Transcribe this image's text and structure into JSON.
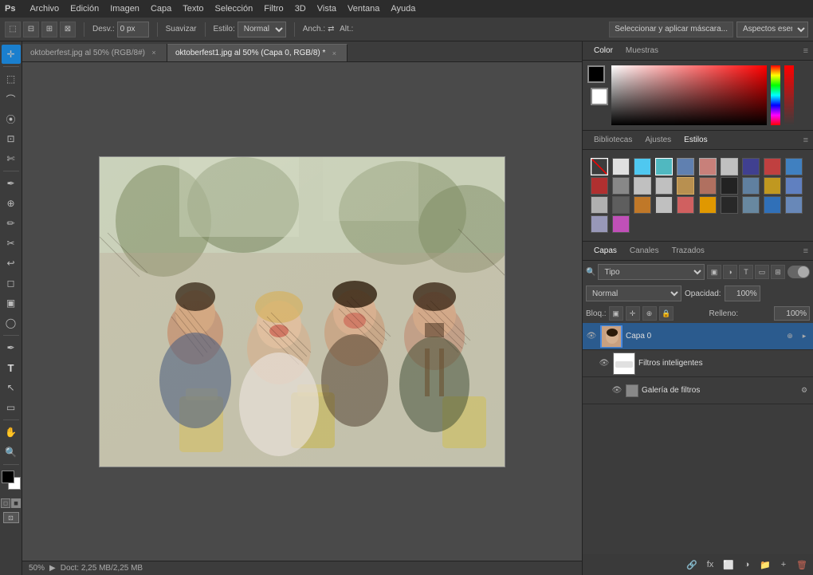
{
  "app": {
    "logo": "Ps",
    "menu_items": [
      "Archivo",
      "Edición",
      "Imagen",
      "Capa",
      "Texto",
      "Selección",
      "Filtro",
      "3D",
      "Vista",
      "Ventana",
      "Ayuda"
    ]
  },
  "toolbar": {
    "desv_label": "Desv.:",
    "desv_value": "0 px",
    "suavizar_label": "Suavizar",
    "estilo_label": "Estilo:",
    "estilo_value": "Normal",
    "anch_label": "Anch.:",
    "alt_label": "Alt.:",
    "mask_button": "Seleccionar y aplicar máscara...",
    "aspects_button": "Aspectos esen."
  },
  "tabs": [
    {
      "label": "oktoberfest.jpg al 50% (RGB/8#)",
      "active": false,
      "modified": false
    },
    {
      "label": "oktoberfest1.jpg al 50% (Capa 0, RGB/8) *",
      "active": true,
      "modified": true
    }
  ],
  "color_panel": {
    "tabs": [
      "Color",
      "Muestras"
    ],
    "active_tab": "Color"
  },
  "styles_panel": {
    "tabs": [
      "Bibliotecas",
      "Ajustes",
      "Estilos"
    ],
    "active_tab": "Estilos"
  },
  "layers_panel": {
    "tabs": [
      "Capas",
      "Canales",
      "Trazados"
    ],
    "active_tab": "Capas",
    "blend_mode": "Normal",
    "opacity_label": "Opacidad:",
    "opacity_value": "100%",
    "lock_label": "Bloq.:",
    "fill_label": "Relleno:",
    "fill_value": "100%",
    "filter_options": [
      "Tipo"
    ],
    "layers": [
      {
        "name": "Capa 0",
        "visible": true,
        "active": true,
        "type": "normal",
        "has_fx": true
      },
      {
        "name": "Filtros inteligentes",
        "visible": true,
        "active": false,
        "type": "filter-group",
        "indent": true
      },
      {
        "name": "Galería de filtros",
        "visible": true,
        "active": false,
        "type": "filter",
        "indent": true
      }
    ]
  },
  "status_bar": {
    "zoom": "50%",
    "doc_info": "Doct: 2,25 MB/2,25 MB"
  },
  "tools": [
    {
      "name": "move",
      "icon": "✛",
      "title": "Mover"
    },
    {
      "name": "marquee-rect",
      "icon": "⬚",
      "title": "Marco rectangular"
    },
    {
      "name": "marquee-ellipse",
      "icon": "⬭",
      "title": "Marco elíptico"
    },
    {
      "name": "lasso",
      "icon": "𝓛",
      "title": "Lazo"
    },
    {
      "name": "quick-select",
      "icon": "⦿",
      "title": "Selección rápida"
    },
    {
      "name": "crop",
      "icon": "⊡",
      "title": "Recortar"
    },
    {
      "name": "eyedropper",
      "icon": "✒",
      "title": "Cuentagotas"
    },
    {
      "name": "spot-heal",
      "icon": "⊕",
      "title": "Pincel corrector puntual"
    },
    {
      "name": "brush",
      "icon": "✏",
      "title": "Pincel"
    },
    {
      "name": "clone",
      "icon": "✂",
      "title": "Sello de clonar"
    },
    {
      "name": "history-brush",
      "icon": "↩",
      "title": "Pincel de historial"
    },
    {
      "name": "eraser",
      "icon": "◻",
      "title": "Borrador"
    },
    {
      "name": "gradient",
      "icon": "▣",
      "title": "Degradado"
    },
    {
      "name": "dodge",
      "icon": "◯",
      "title": "Sobreexponer"
    },
    {
      "name": "pen",
      "icon": "✒",
      "title": "Pluma"
    },
    {
      "name": "text",
      "icon": "T",
      "title": "Texto"
    },
    {
      "name": "path-select",
      "icon": "↖",
      "title": "Selección de trazado"
    },
    {
      "name": "shape",
      "icon": "▭",
      "title": "Forma"
    },
    {
      "name": "hand",
      "icon": "✋",
      "title": "Mano"
    },
    {
      "name": "zoom",
      "icon": "🔍",
      "title": "Zoom"
    }
  ],
  "style_swatches": [
    "transparent",
    "#ffffff",
    "#4fc8f0",
    "#4fc8f0",
    "#7090c0",
    "#c07080",
    "#c0c0c0",
    "#303080",
    "#c04040",
    "#4080c0",
    "#c04040",
    "#c0c0c0",
    "#c0c0c0",
    "#c0c0c0",
    "#c08040",
    "#c07060",
    "#303030",
    "#7090a0",
    "#c0a030",
    "#7090c0",
    "#c0c0c0",
    "#787878",
    "#c08030",
    "#c0c0c0",
    "#d06060",
    "#e0a000",
    "#303030",
    "#7090a0",
    "#4080c0",
    "#7090c0",
    "#a0a0c0",
    "#d060c0"
  ]
}
